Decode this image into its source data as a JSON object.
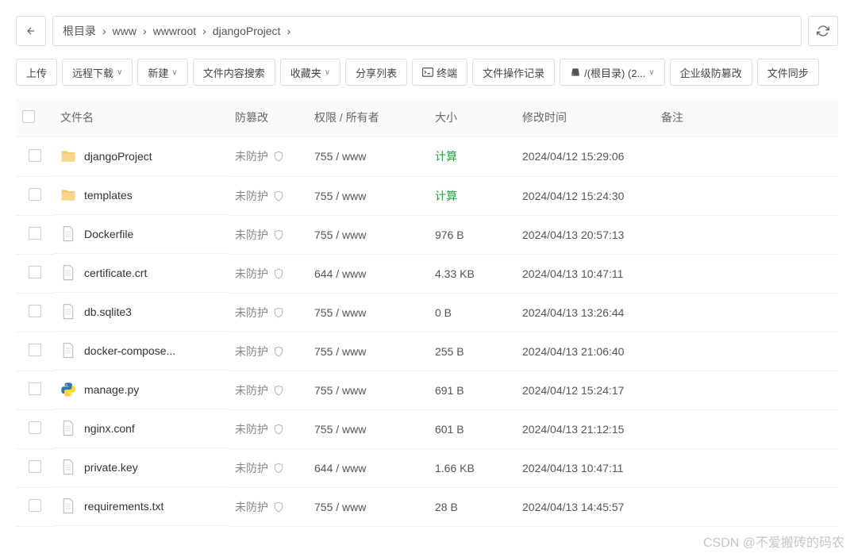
{
  "breadcrumb": {
    "items": [
      "根目录",
      "www",
      "wwwroot",
      "djangoProject"
    ]
  },
  "toolbar": {
    "upload": "上传",
    "remote_download": "远程下载",
    "new": "新建",
    "content_search": "文件内容搜索",
    "favorites": "收藏夹",
    "share_list": "分享列表",
    "terminal": "终端",
    "file_op_log": "文件操作记录",
    "root_path": "/(根目录) (2...",
    "enterprise_protect": "企业级防篡改",
    "file_sync": "文件同步"
  },
  "columns": {
    "name": "文件名",
    "protect": "防篡改",
    "permission": "权限 / 所有者",
    "size": "大小",
    "mtime": "修改时间",
    "remark": "备注"
  },
  "protect_label": "未防护",
  "rows": [
    {
      "icon": "folder",
      "name": "djangoProject",
      "perm": "755 / www",
      "size": "计算",
      "size_calc": true,
      "mtime": "2024/04/12 15:29:06"
    },
    {
      "icon": "folder",
      "name": "templates",
      "perm": "755 / www",
      "size": "计算",
      "size_calc": true,
      "mtime": "2024/04/12 15:24:30"
    },
    {
      "icon": "file",
      "name": "Dockerfile",
      "perm": "755 / www",
      "size": "976 B",
      "mtime": "2024/04/13 20:57:13"
    },
    {
      "icon": "file",
      "name": "certificate.crt",
      "perm": "644 / www",
      "size": "4.33 KB",
      "mtime": "2024/04/13 10:47:11"
    },
    {
      "icon": "file",
      "name": "db.sqlite3",
      "perm": "755 / www",
      "size": "0 B",
      "mtime": "2024/04/13 13:26:44"
    },
    {
      "icon": "file",
      "name": "docker-compose...",
      "perm": "755 / www",
      "size": "255 B",
      "mtime": "2024/04/13 21:06:40"
    },
    {
      "icon": "python",
      "name": "manage.py",
      "perm": "755 / www",
      "size": "691 B",
      "mtime": "2024/04/12 15:24:17"
    },
    {
      "icon": "file",
      "name": "nginx.conf",
      "perm": "755 / www",
      "size": "601 B",
      "mtime": "2024/04/13 21:12:15"
    },
    {
      "icon": "file",
      "name": "private.key",
      "perm": "644 / www",
      "size": "1.66 KB",
      "mtime": "2024/04/13 10:47:11"
    },
    {
      "icon": "file",
      "name": "requirements.txt",
      "perm": "755 / www",
      "size": "28 B",
      "mtime": "2024/04/13 14:45:57"
    }
  ],
  "watermark": "CSDN @不爱搬砖的码农"
}
